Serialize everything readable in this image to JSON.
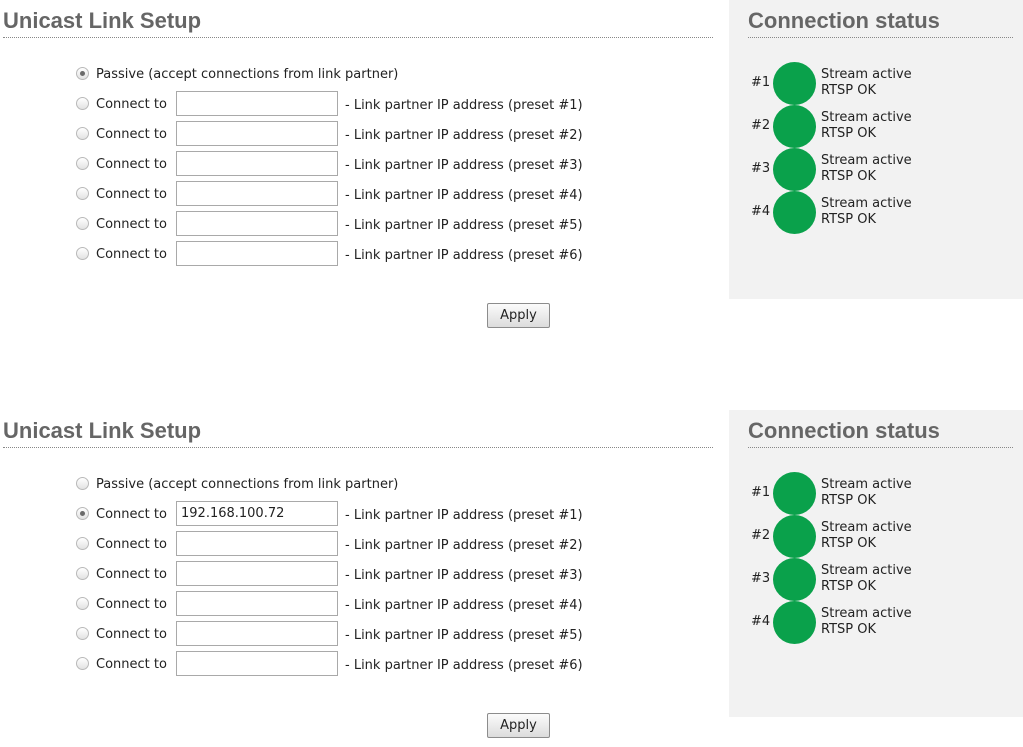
{
  "panels": [
    {
      "setup_title": "Unicast Link Setup",
      "passive": {
        "label": "Passive (accept connections from link partner)",
        "checked": true
      },
      "connect_rows": [
        {
          "label": "Connect to",
          "value": "",
          "suffix": "- Link partner IP address (preset #1)",
          "checked": false
        },
        {
          "label": "Connect to",
          "value": "",
          "suffix": "- Link partner IP address (preset #2)",
          "checked": false
        },
        {
          "label": "Connect to",
          "value": "",
          "suffix": "- Link partner IP address (preset #3)",
          "checked": false
        },
        {
          "label": "Connect to",
          "value": "",
          "suffix": "- Link partner IP address (preset #4)",
          "checked": false
        },
        {
          "label": "Connect to",
          "value": "",
          "suffix": "- Link partner IP address (preset #5)",
          "checked": false
        },
        {
          "label": "Connect to",
          "value": "",
          "suffix": "- Link partner IP address (preset #6)",
          "checked": false
        }
      ],
      "apply_label": "Apply",
      "status_title": "Connection status",
      "status": [
        {
          "num": "#1",
          "line1": "Stream active",
          "line2": "RTSP OK",
          "color": "#0aa14b"
        },
        {
          "num": "#2",
          "line1": "Stream active",
          "line2": "RTSP OK",
          "color": "#0aa14b"
        },
        {
          "num": "#3",
          "line1": "Stream active",
          "line2": "RTSP OK",
          "color": "#0aa14b"
        },
        {
          "num": "#4",
          "line1": "Stream active",
          "line2": "RTSP OK",
          "color": "#0aa14b"
        }
      ]
    },
    {
      "setup_title": "Unicast Link Setup",
      "passive": {
        "label": "Passive (accept connections from link partner)",
        "checked": false
      },
      "connect_rows": [
        {
          "label": "Connect to",
          "value": "192.168.100.72",
          "suffix": "- Link partner IP address (preset #1)",
          "checked": true
        },
        {
          "label": "Connect to",
          "value": "",
          "suffix": "- Link partner IP address (preset #2)",
          "checked": false
        },
        {
          "label": "Connect to",
          "value": "",
          "suffix": "- Link partner IP address (preset #3)",
          "checked": false
        },
        {
          "label": "Connect to",
          "value": "",
          "suffix": "- Link partner IP address (preset #4)",
          "checked": false
        },
        {
          "label": "Connect to",
          "value": "",
          "suffix": "- Link partner IP address (preset #5)",
          "checked": false
        },
        {
          "label": "Connect to",
          "value": "",
          "suffix": "- Link partner IP address (preset #6)",
          "checked": false
        }
      ],
      "apply_label": "Apply",
      "status_title": "Connection status",
      "status": [
        {
          "num": "#1",
          "line1": "Stream active",
          "line2": "RTSP OK",
          "color": "#0aa14b"
        },
        {
          "num": "#2",
          "line1": "Stream active",
          "line2": "RTSP OK",
          "color": "#0aa14b"
        },
        {
          "num": "#3",
          "line1": "Stream active",
          "line2": "RTSP OK",
          "color": "#0aa14b"
        },
        {
          "num": "#4",
          "line1": "Stream active",
          "line2": "RTSP OK",
          "color": "#0aa14b"
        }
      ]
    }
  ]
}
